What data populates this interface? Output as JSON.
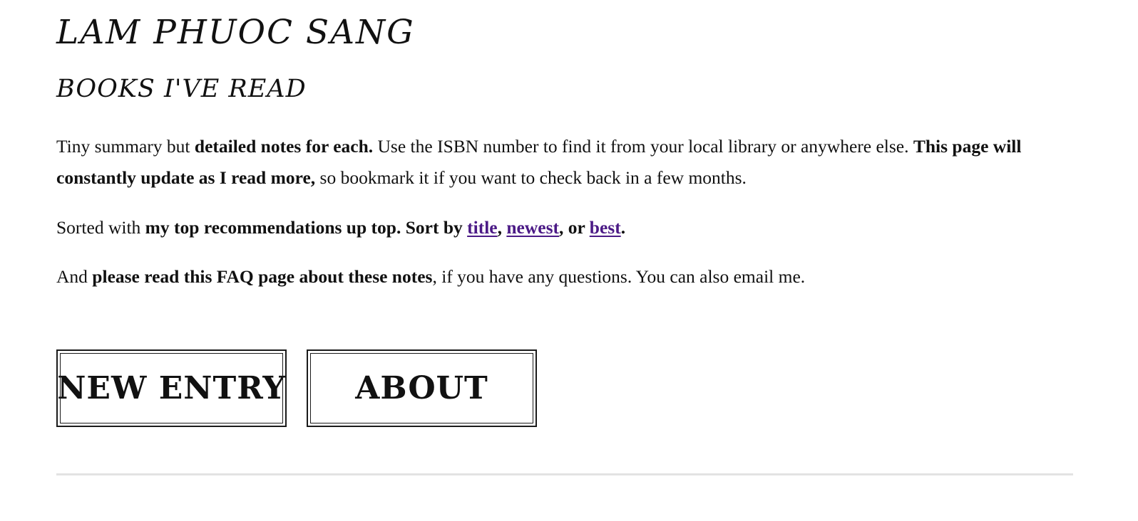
{
  "header": {
    "site_title": "LAM PHUOC SANG",
    "section_title": "BOOKS I'VE READ"
  },
  "intro": {
    "p1_a": "Tiny summary but ",
    "p1_b": "detailed notes for each.",
    "p1_c": " Use the ISBN number to find it from your local library or anywhere else. ",
    "p1_d": "This page will constantly update as I read more,",
    "p1_e": " so bookmark it if you want to check back in a few months."
  },
  "sort": {
    "prefix": "Sorted with ",
    "bold_text": "my top recommendations up top. Sort by ",
    "link_title": "title",
    "sep1": ", ",
    "link_newest": "newest",
    "sep2": ", or ",
    "link_best": "best",
    "end": "."
  },
  "faq": {
    "prefix": "And ",
    "bold_text": "please read this FAQ page about these notes",
    "suffix": ", if you have any questions. You can also email me."
  },
  "buttons": {
    "new_entry": "NEW ENTRY",
    "about": "ABOUT"
  },
  "colors": {
    "link": "#4b1a86",
    "text": "#111111",
    "divider": "#e3e3e3"
  }
}
